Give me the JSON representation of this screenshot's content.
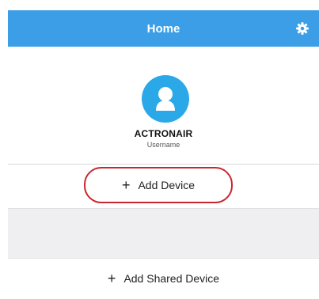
{
  "header": {
    "title": "Home",
    "settings_icon": "gear-icon",
    "color": "#3b9ee6"
  },
  "profile": {
    "avatar_icon": "user-avatar-icon",
    "avatar_color": "#2ba8e8",
    "name": "ACTRONAIR",
    "subtitle": "Username"
  },
  "actions": {
    "add_device_label": "Add Device",
    "add_device_icon": "plus-icon",
    "highlight_color": "#c8262e",
    "add_shared_label": "Add Shared Device",
    "add_shared_icon": "plus-icon"
  }
}
